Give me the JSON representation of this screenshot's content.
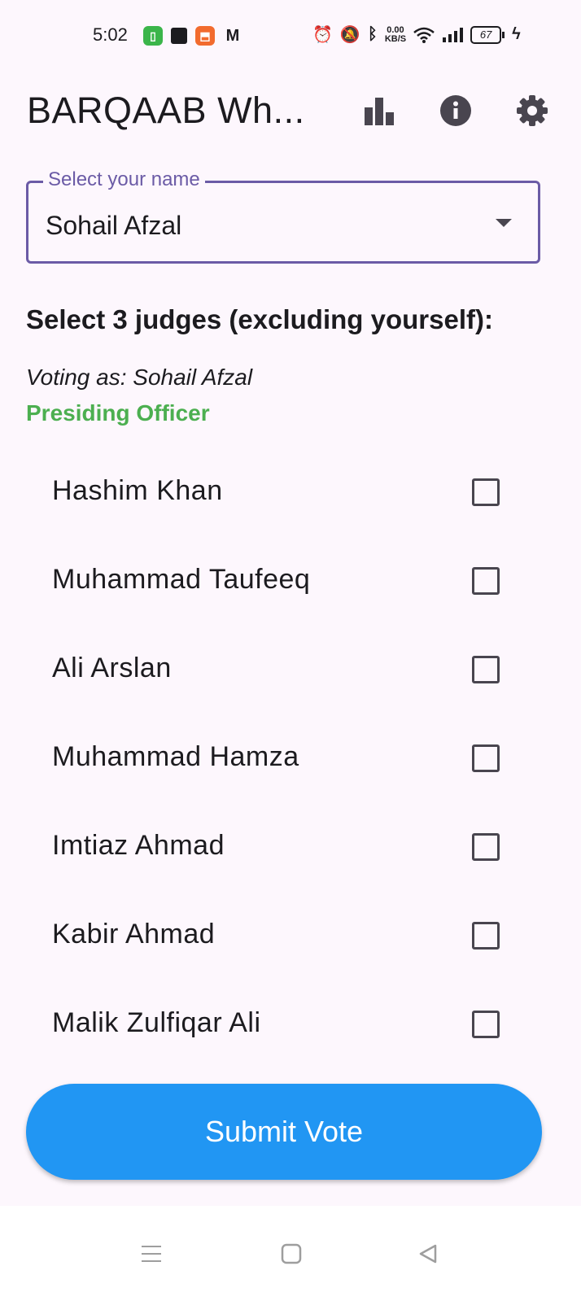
{
  "status_bar": {
    "time": "5:02",
    "net_speed_value": "0.00",
    "net_speed_unit": "KB/S",
    "battery": "67"
  },
  "app_bar": {
    "title": "BARQAAB Wh...",
    "actions": [
      "bar-chart-icon",
      "info-icon",
      "gear-icon"
    ]
  },
  "name_field": {
    "label": "Select your name",
    "value": "Sohail Afzal"
  },
  "section_title": "Select 3 judges (excluding yourself):",
  "voting_as": "Voting as: Sohail Afzal",
  "role": "Presiding Officer",
  "judges": [
    {
      "name": "Hashim Khan",
      "checked": false
    },
    {
      "name": "Muhammad Taufeeq",
      "checked": false
    },
    {
      "name": "Ali Arslan",
      "checked": false
    },
    {
      "name": "Muhammad Hamza",
      "checked": false
    },
    {
      "name": "Imtiaz Ahmad",
      "checked": false
    },
    {
      "name": "Kabir Ahmad",
      "checked": false
    },
    {
      "name": "Malik Zulfiqar Ali",
      "checked": false
    }
  ],
  "submit_label": "Submit Vote",
  "colors": {
    "accent": "#6b5ba6",
    "role": "#4caf50",
    "submit": "#2196f3",
    "background": "#fdf7fd"
  }
}
